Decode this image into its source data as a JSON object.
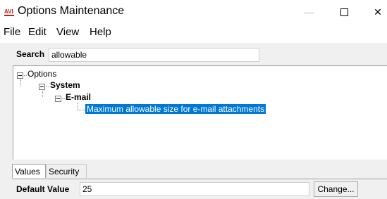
{
  "window": {
    "title": "Options Maintenance",
    "icon": "avi-app-icon",
    "icon_text": "AVI",
    "minimize_glyph": "—",
    "close_glyph": "✕"
  },
  "menu": {
    "file": "File",
    "edit": "Edit",
    "view": "View",
    "help": "Help"
  },
  "search": {
    "label": "Search",
    "value": "allowable"
  },
  "tree": {
    "root": "Options",
    "system": "System",
    "email": "E-mail",
    "selected_item": "Maximum allowable size for e-mail attachments"
  },
  "tabs": {
    "values": "Values",
    "security": "Security"
  },
  "default_value": {
    "label": "Default Value",
    "value": "25",
    "change_button": "Change..."
  },
  "colors": {
    "selection": "#0078d7",
    "panel_background": "#f0f0f0",
    "icon_red": "#d11a1a"
  }
}
